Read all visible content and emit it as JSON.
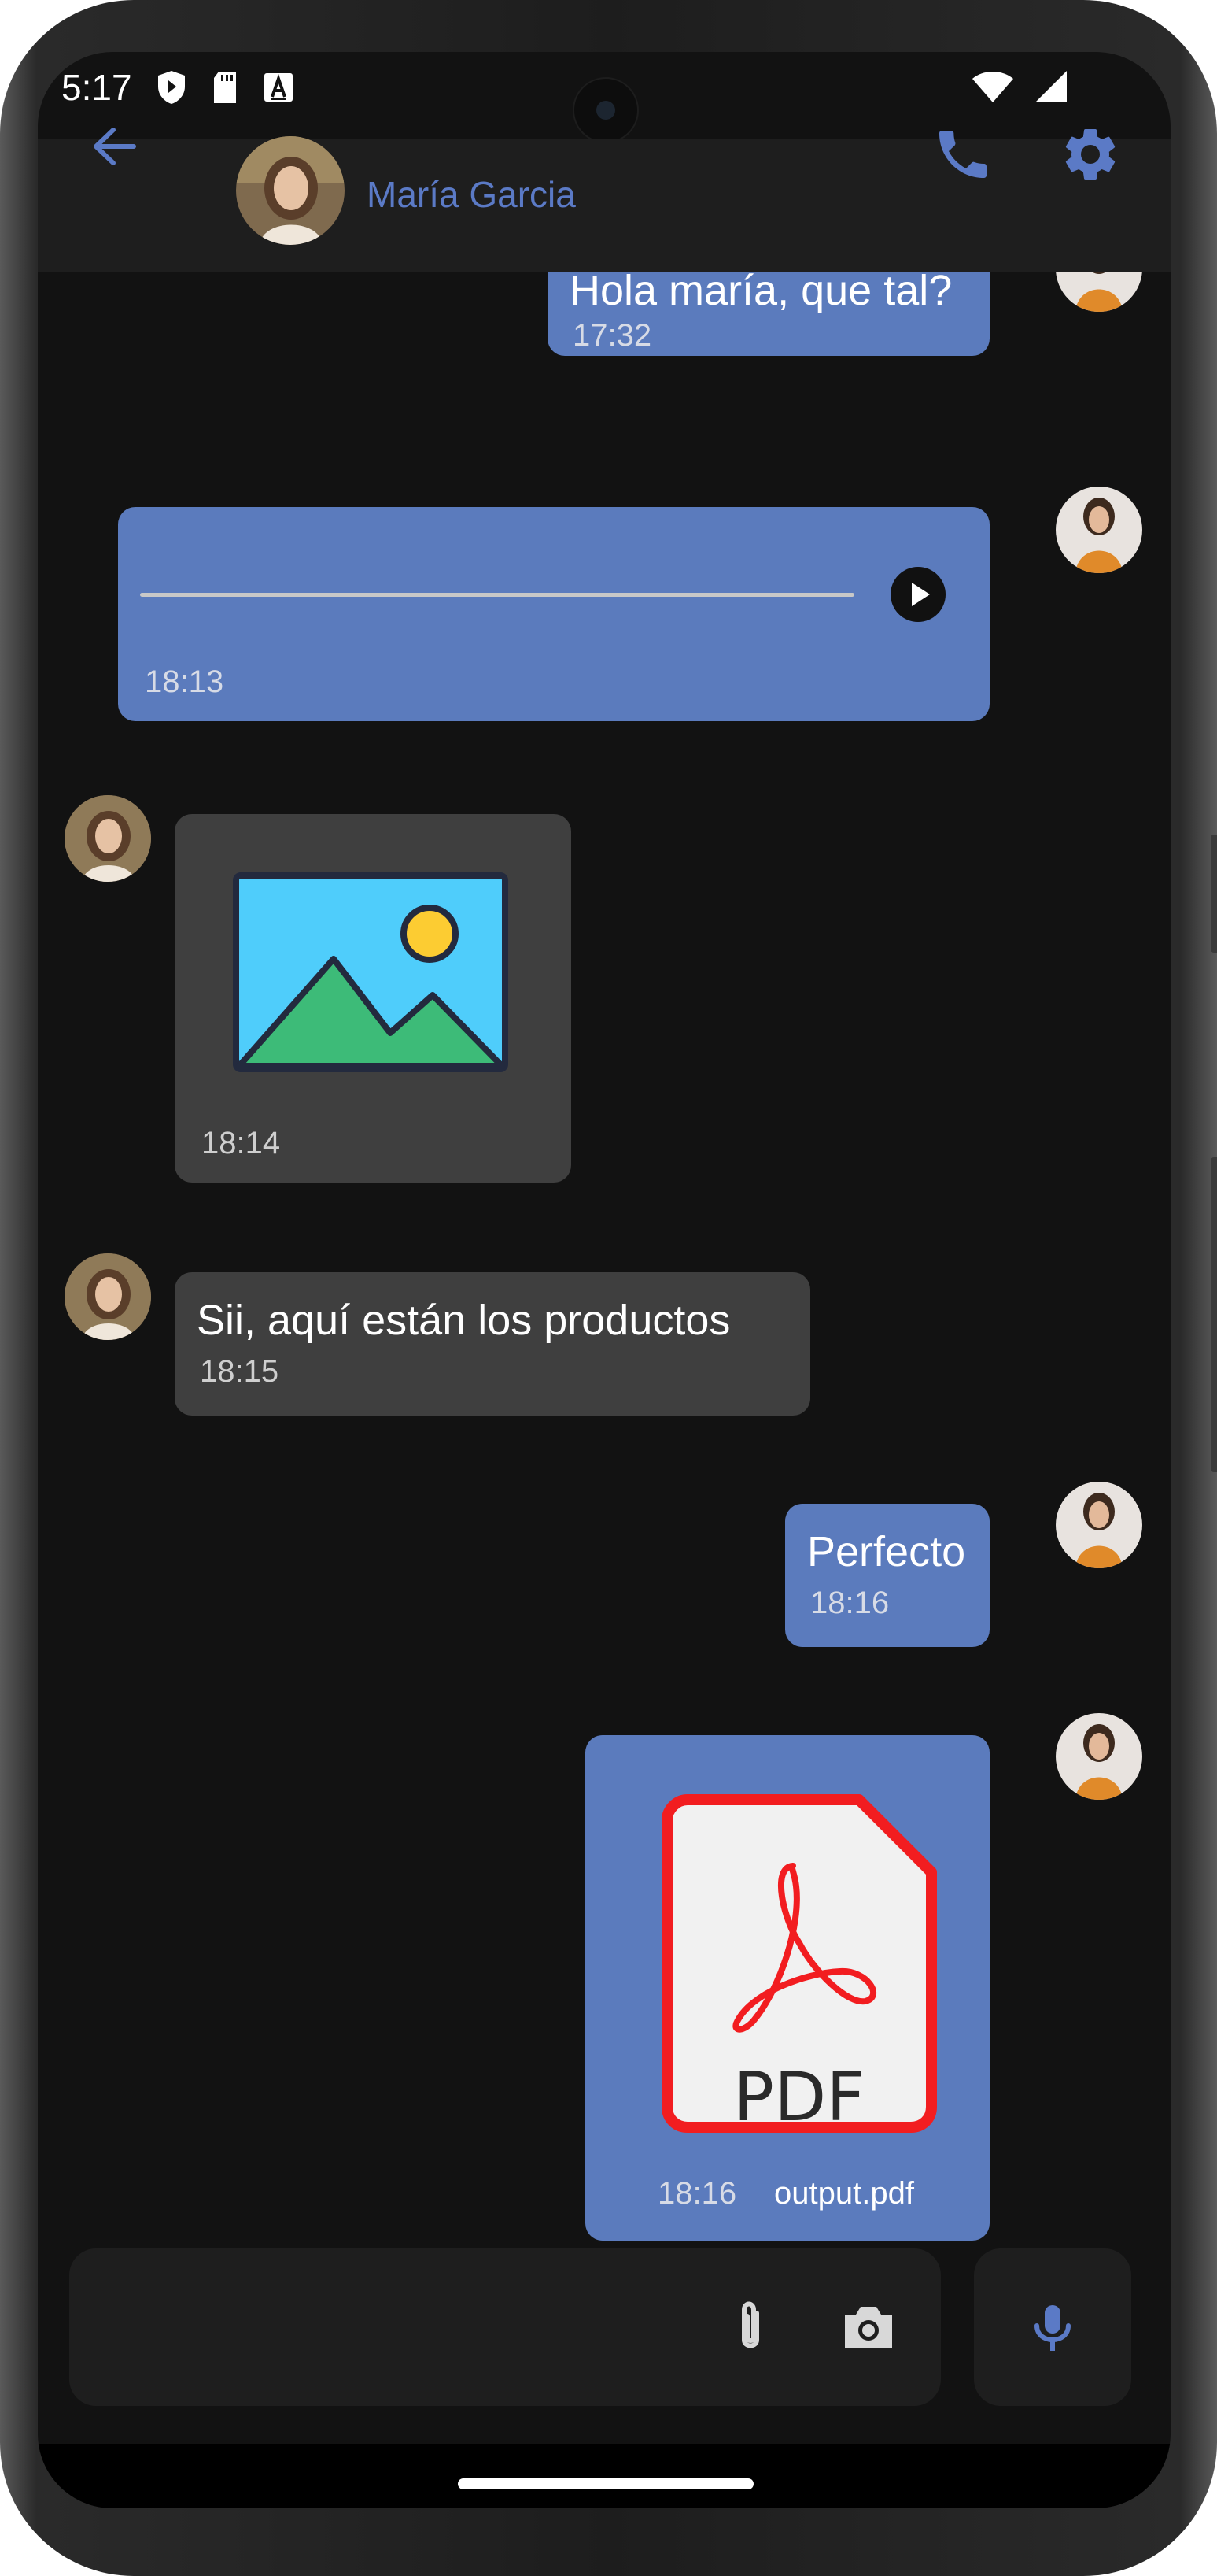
{
  "status_bar": {
    "time": "5:17"
  },
  "header": {
    "contact_name": "María Garcia",
    "accent_color": "#5b7ac6"
  },
  "messages": [
    {
      "type": "text",
      "sender": "me",
      "text": "Hola maría, que tal?",
      "time": "17:32"
    },
    {
      "type": "audio",
      "sender": "me",
      "time": "18:13",
      "progress": 0
    },
    {
      "type": "image",
      "sender": "contact",
      "time": "18:14"
    },
    {
      "type": "text",
      "sender": "contact",
      "text": "Sii, aquí están los productos",
      "time": "18:15"
    },
    {
      "type": "text",
      "sender": "me",
      "text": "Perfecto",
      "time": "18:16"
    },
    {
      "type": "file",
      "sender": "me",
      "file_label": "PDF",
      "file_name": "output.pdf",
      "time": "18:16"
    }
  ],
  "composer": {
    "text": ""
  },
  "colors": {
    "my_bubble": "#5b7bbd",
    "their_bubble": "#3f3f3f",
    "background": "#121212"
  }
}
